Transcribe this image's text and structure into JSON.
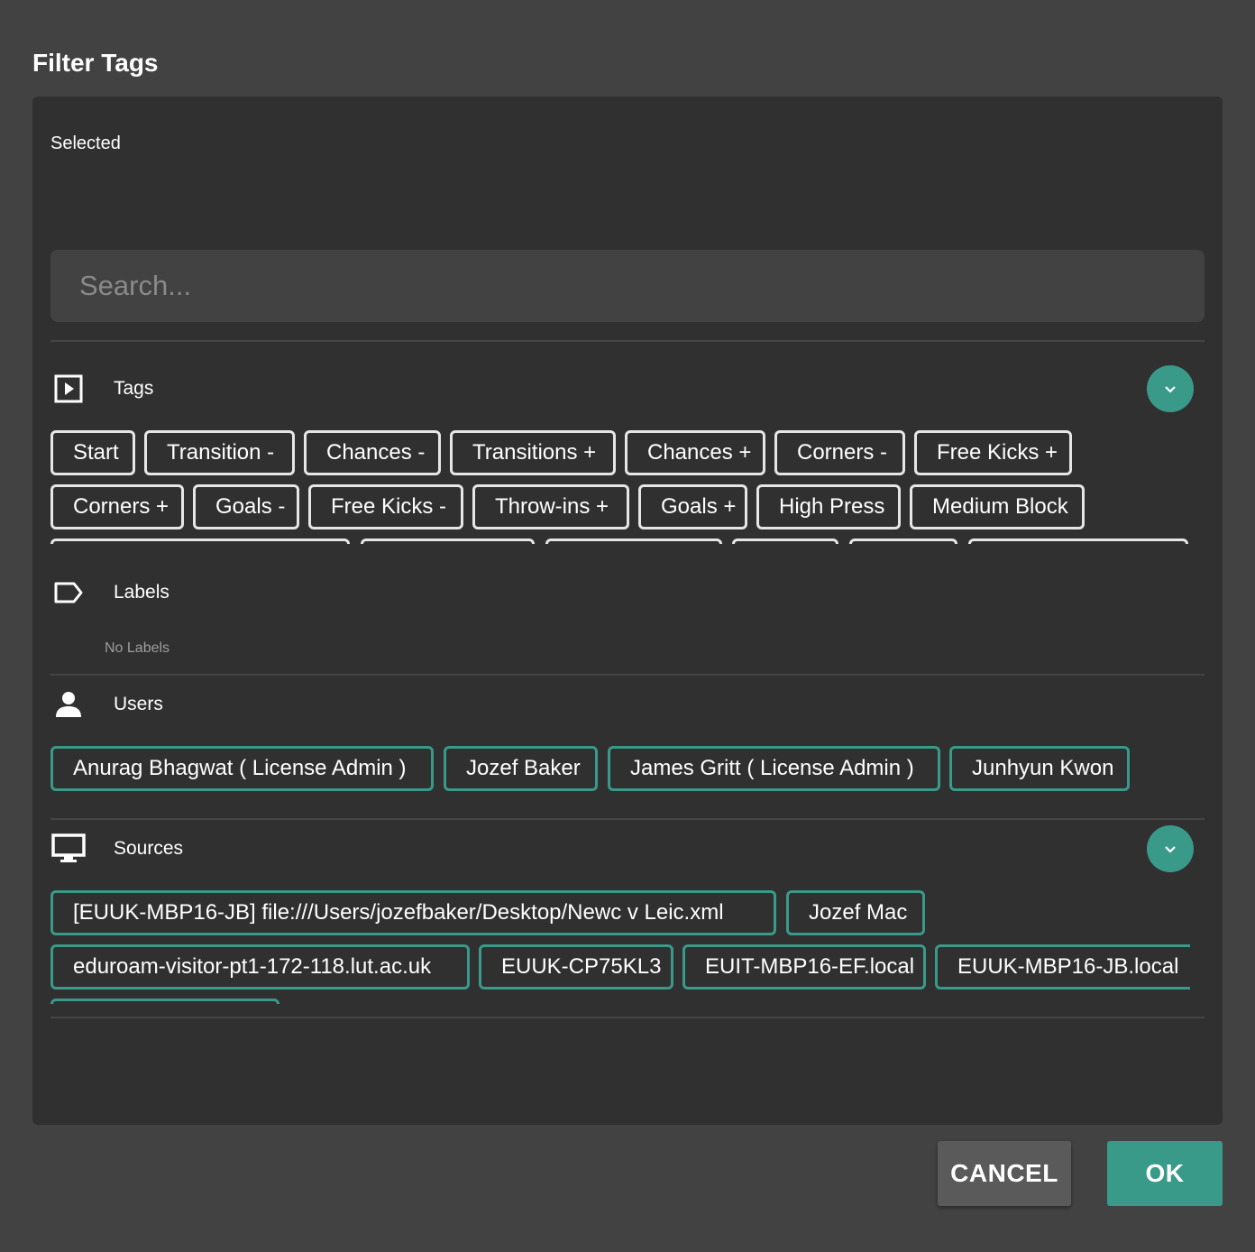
{
  "dialog": {
    "title": "Filter Tags"
  },
  "selected": {
    "label": "Selected"
  },
  "search": {
    "placeholder": "Search..."
  },
  "tags": {
    "title": "Tags",
    "icon": "play-box-icon",
    "row1": [
      "Start",
      "Transition -",
      "Chances -",
      "Transitions +",
      "Chances +",
      "Corners -",
      "Free Kicks +"
    ],
    "row2": [
      "Corners +",
      "Goals -",
      "Free Kicks -",
      "Throw-ins +",
      "Goals +",
      "High Press",
      "Medium Block"
    ]
  },
  "labels": {
    "title": "Labels",
    "icon": "label-tag-icon",
    "empty_text": "No Labels"
  },
  "users": {
    "title": "Users",
    "icon": "person-icon",
    "items": [
      "Anurag Bhagwat ( License Admin )",
      "Jozef Baker",
      "James Gritt ( License Admin )",
      "Junhyun Kwon"
    ]
  },
  "sources": {
    "title": "Sources",
    "icon": "monitor-icon",
    "row1": [
      "[EUUK-MBP16-JB] file:///Users/jozefbaker/Desktop/Newc v Leic.xml",
      "Jozef Mac"
    ],
    "row2": [
      "eduroam-visitor-pt1-172-118.lut.ac.uk",
      "EUUK-CP75KL3",
      "EUIT-MBP16-EF.local",
      "EUUK-MBP16-JB.local"
    ]
  },
  "buttons": {
    "cancel": "CANCEL",
    "ok": "OK"
  },
  "colors": {
    "accent": "#3a9a8a",
    "background": "#424242",
    "panel": "#303030"
  }
}
